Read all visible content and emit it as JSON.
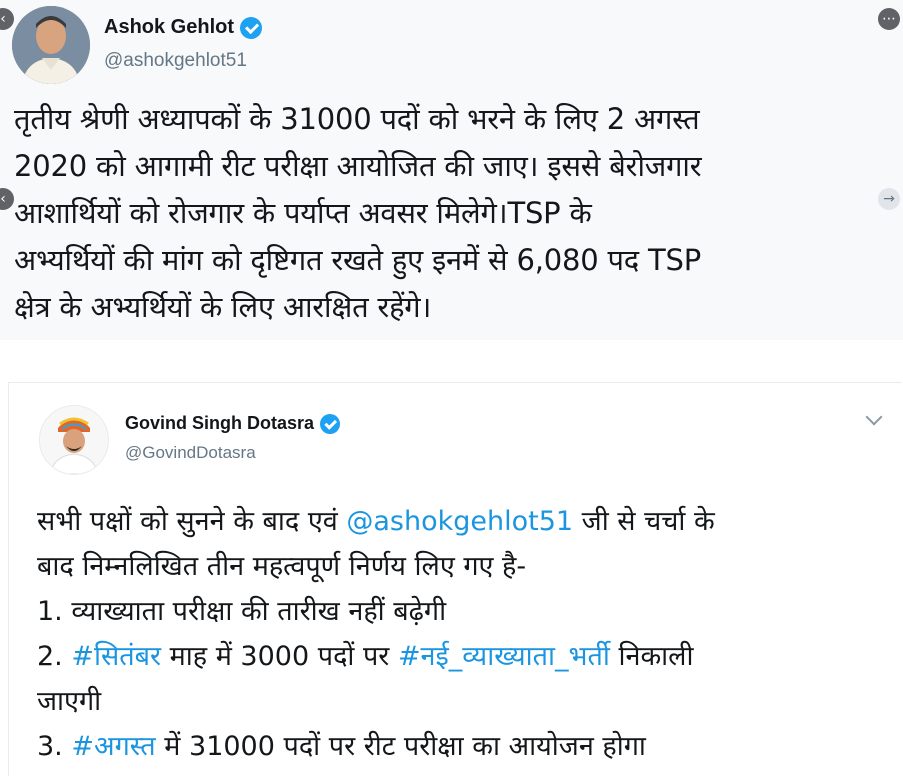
{
  "tweet1": {
    "author_name": "Ashok Gehlot",
    "author_handle": "@ashokgehlot51",
    "body_lines": [
      "तृतीय श्रेणी अध्यापकों के 31000 पदों को भरने के लिए 2 अगस्त",
      "2020 को आगामी रीट परीक्षा आयोजित की जाए। इससे बेरोजगार",
      "आशार्थियों को रोजगार के पर्याप्त अवसर मिलेगे।TSP के",
      "अभ्यर्थियों की मांग को दृष्टिगत रखते हुए इनमें से 6,080 पद TSP",
      "क्षेत्र के अभ्यर्थियों के लिए आरक्षित रहेंगे।"
    ]
  },
  "tweet2": {
    "author_name": "Govind Singh Dotasra",
    "author_handle": "@GovindDotasra",
    "line1_pre": "सभी पक्षों को सुनने के बाद एवं ",
    "line1_mention": "@ashokgehlot51",
    "line1_post": " जी से चर्चा के",
    "line2": "बाद निम्नलिखित तीन महत्वपूर्ण निर्णय लिए गए है-",
    "line3": "1. व्याख्याता परीक्षा की तारीख नहीं बढ़ेगी",
    "line4_pre": "2. ",
    "line4_hashtag1": "#सितंबर",
    "line4_mid": " माह में 3000 पदों पर ",
    "line4_hashtag2": "#नई_व्याख्याता_भर्ती",
    "line4_post": " निकाली",
    "line5": "जाएगी",
    "line6_pre": "3. ",
    "line6_hashtag": "#अगस्त",
    "line6_post": " में 31000 पदों पर रीट परीक्षा का आयोजन होगा"
  },
  "colors": {
    "link": "#1b95e0",
    "verified": "#1da1f2",
    "handle": "#657786"
  },
  "icons": [
    "verified-badge-icon",
    "chevron-down-icon",
    "avatar-image"
  ]
}
